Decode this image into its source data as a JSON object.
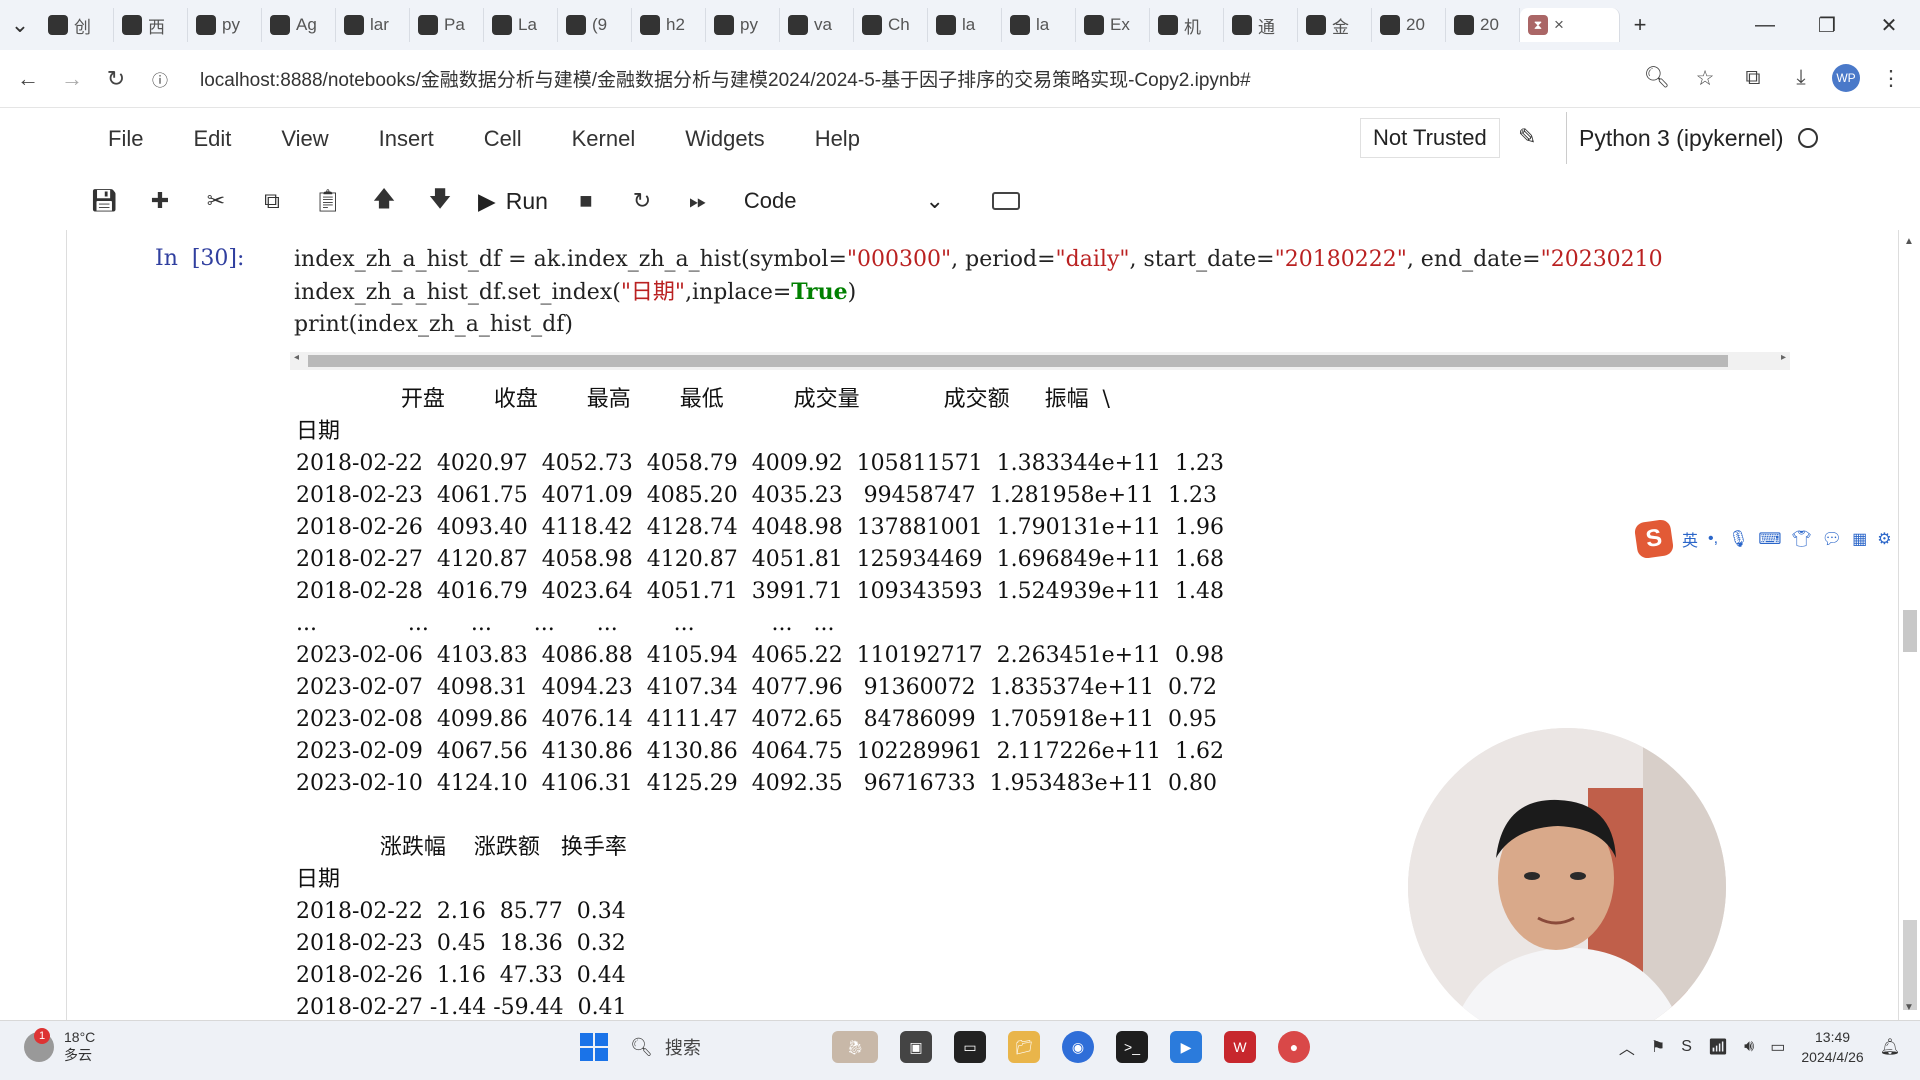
{
  "browser": {
    "tabs": [
      {
        "icon": "calendar-icon",
        "label": "创"
      },
      {
        "icon": "video-icon",
        "label": "西"
      },
      {
        "icon": "github-icon",
        "label": "py"
      },
      {
        "icon": "mail-icon",
        "label": "Ag"
      },
      {
        "icon": "github-icon",
        "label": "lar"
      },
      {
        "icon": "mail-icon",
        "label": "Pa"
      },
      {
        "icon": "vx-icon",
        "label": "La"
      },
      {
        "icon": "zhihu-icon",
        "label": "(9"
      },
      {
        "icon": "github-icon",
        "label": "h2"
      },
      {
        "icon": "c-icon",
        "label": "py"
      },
      {
        "icon": "github-icon",
        "label": "va"
      },
      {
        "icon": "mail-icon",
        "label": "Ch"
      },
      {
        "icon": "book-icon",
        "label": "la"
      },
      {
        "icon": "book-icon",
        "label": "la"
      },
      {
        "icon": "avatar-icon",
        "label": "Ex"
      },
      {
        "icon": "app-icon",
        "label": "机"
      },
      {
        "icon": "gear-icon",
        "label": "通"
      },
      {
        "icon": "loading-icon",
        "label": "金"
      },
      {
        "icon": "notebook-icon",
        "label": "20"
      },
      {
        "icon": "notebook-icon",
        "label": "20"
      }
    ],
    "active_tab_close": "×",
    "new_tab": "+",
    "url": "localhost:8888/notebooks/金融数据分析与建模/金融数据分析与建模2024/2024-5-基于因子排序的交易策略实现-Copy2.ipynb#"
  },
  "jupyter": {
    "menu": [
      "File",
      "Edit",
      "View",
      "Insert",
      "Cell",
      "Kernel",
      "Widgets",
      "Help"
    ],
    "trust": "Not Trusted",
    "kernel": "Python 3 (ipykernel)",
    "run_label": "Run",
    "cell_type": "Code"
  },
  "cell": {
    "prompt": "In  [30]:",
    "code_lines": [
      "index_zh_a_hist_df = ak.index_zh_a_hist(symbol=\"000300\", period=\"daily\", start_date=\"20180222\", end_date=\"20230210",
      "index_zh_a_hist_df.set_index(\"日期\",inplace=True)",
      "print(index_zh_a_hist_df)"
    ],
    "output_lines": [
      "               开盘       收盘       最高       最低          成交量            成交额     振幅  \\",
      "日期",
      "2018-02-22  4020.97  4052.73  4058.79  4009.92  105811571  1.383344e+11  1.23",
      "2018-02-23  4061.75  4071.09  4085.20  4035.23   99458747  1.281958e+11  1.23",
      "2018-02-26  4093.40  4118.42  4128.74  4048.98  137881001  1.790131e+11  1.96",
      "2018-02-27  4120.87  4058.98  4120.87  4051.81  125934469  1.696849e+11  1.68",
      "2018-02-28  4016.79  4023.64  4051.71  3991.71  109343593  1.524939e+11  1.48",
      "...             ...      ...      ...      ...        ...           ...   ...",
      "2023-02-06  4103.83  4086.88  4105.94  4065.22  110192717  2.263451e+11  0.98",
      "2023-02-07  4098.31  4094.23  4107.34  4077.96   91360072  1.835374e+11  0.72",
      "2023-02-08  4099.86  4076.14  4111.47  4072.65   84786099  1.705918e+11  0.95",
      "2023-02-09  4067.56  4130.86  4130.86  4064.75  102289961  2.117226e+11  1.62",
      "2023-02-10  4124.10  4106.31  4125.29  4092.35   96716733  1.953483e+11  0.80",
      "",
      "            涨跌幅    涨跌额   换手率",
      "日期",
      "2018-02-22  2.16  85.77  0.34",
      "2018-02-23  0.45  18.36  0.32",
      "2018-02-26  1.16  47.33  0.44",
      "2018-02-27 -1.44 -59.44  0.41"
    ]
  },
  "ime": {
    "lang": "英"
  },
  "taskbar": {
    "weather_temp": "18°C",
    "weather_desc": "多云",
    "search": "搜索",
    "time": "13:49",
    "date": "2024/4/26"
  }
}
